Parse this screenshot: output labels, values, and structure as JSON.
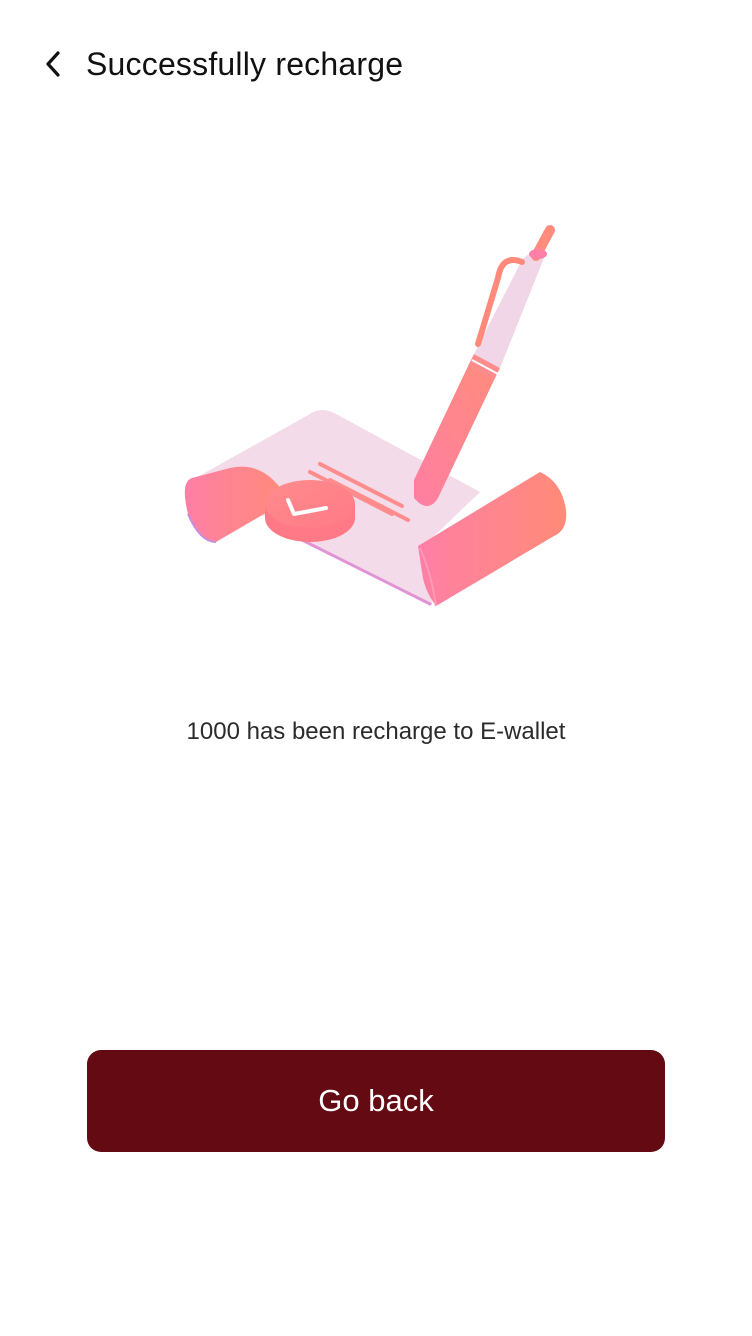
{
  "header": {
    "title": "Successfully recharge",
    "back_icon": "chevron-left-icon"
  },
  "illustration": {
    "name": "signed-receipt-illustration",
    "colors": {
      "paper": "#f3dbe9",
      "accent_pink": "#ff7fa6",
      "accent_coral": "#ff8a7a",
      "pen_body": "#f0d6e6"
    }
  },
  "main": {
    "message": "1000 has been recharge to E-wallet"
  },
  "actions": {
    "go_back_label": "Go back"
  },
  "theme": {
    "button_color": "#640a13",
    "button_text_color": "#ffffff"
  }
}
